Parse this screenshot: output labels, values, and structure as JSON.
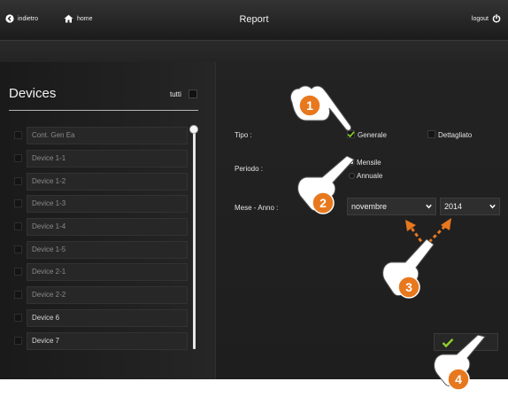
{
  "header": {
    "back_label": "indietro",
    "home_label": "home",
    "title": "Report",
    "logout_label": "logout"
  },
  "devices": {
    "title": "Devices",
    "select_all_label": "tutti",
    "items": [
      {
        "label": "Cont. Gen Ea"
      },
      {
        "label": "Device 1-1"
      },
      {
        "label": "Device 1-2"
      },
      {
        "label": "Device 1-3"
      },
      {
        "label": "Device 1-4"
      },
      {
        "label": "Device 1-5"
      },
      {
        "label": "Device 2-1"
      },
      {
        "label": "Device 2-2"
      },
      {
        "label": "Device 6"
      },
      {
        "label": "Device 7"
      }
    ]
  },
  "form": {
    "tipo_label": "Tipo :",
    "tipo_options": [
      "Generale",
      "Dettagliato"
    ],
    "tipo_selected": "Generale",
    "periodo_label": "Periodo :",
    "periodo_options": [
      "Mensile",
      "Annuale"
    ],
    "periodo_selected": "Mensile",
    "mese_anno_label": "Mese - Anno :",
    "month_value": "novembre",
    "year_value": "2014"
  },
  "callouts": [
    "1",
    "2",
    "3",
    "4"
  ],
  "colors": {
    "callout_orange": "#e8781e",
    "check_green": "#8fd12a"
  }
}
